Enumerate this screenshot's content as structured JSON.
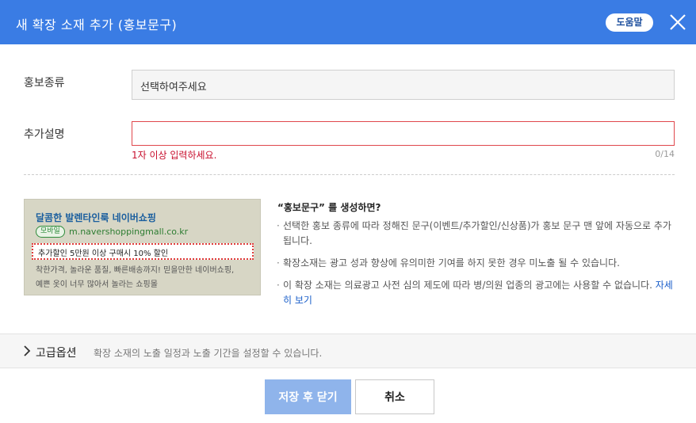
{
  "header": {
    "title": "새 확장 소재 추가 (홍보문구)",
    "help_label": "도움말",
    "close_icon": "close-icon",
    "bg_color": "#3a7ce4"
  },
  "form": {
    "type_label": "홍보종류",
    "type_value": "선택하여주세요",
    "desc_label": "추가설명",
    "desc_value": "",
    "error_message": "1자 이상 입력하세요.",
    "char_count": "0/14"
  },
  "preview": {
    "title": "달콤한 발렌타인룩 네이버쇼핑",
    "badge": "모바일",
    "url": "m.navershoppingmall.co.kr",
    "promo": "추가할인 5만원 이상 구매시 10% 할인",
    "desc_line1": "착한가격, 놀라운 품질, 빠른배송까지! 믿을만한 네이버쇼핑,",
    "desc_line2": "예쁜 옷이 너무 많아서 놀라는 쇼핑몰"
  },
  "info": {
    "title": "“홍보문구” 를 생성하면?",
    "items": [
      "선택한 홍보 종류에 따라 정해진 문구(이벤트/추가할인/신상품)가 홍보 문구 맨 앞에 자동으로 추가됩니다.",
      "확장소재는 광고 성과 향상에 유의미한 기여를 하지 못한 경우 미노출 될 수 있습니다.",
      "이 확장 소재는 의료광고 사전 심의 제도에 따라 병/의원 업종의 광고에는 사용할 수 없습니다."
    ],
    "link_label": "자세히 보기"
  },
  "advanced": {
    "label": "고급옵션",
    "description": "확장 소재의 노출 일정과 노출 기간을 설정할 수 있습니다."
  },
  "footer": {
    "save_label": "저장 후 닫기",
    "cancel_label": "취소"
  }
}
